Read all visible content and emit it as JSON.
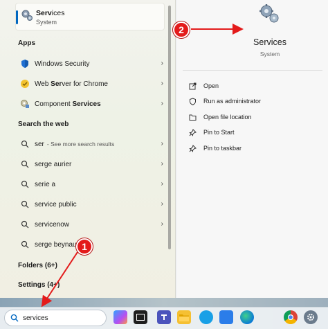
{
  "best_match": {
    "title_highlight": "Serv",
    "title_rest": "ices",
    "subtitle": "System",
    "icon": "gears-icon"
  },
  "sections": {
    "apps": "Apps",
    "web": "Search the web",
    "folders": "Folders (6+)",
    "settings": "Settings (4+)"
  },
  "apps": [
    {
      "label_pre": "Windows Security",
      "label_bold": "",
      "label_post": "",
      "icon": "shield-icon"
    },
    {
      "label_pre": "Web ",
      "label_bold": "Ser",
      "label_post": "ver for Chrome",
      "icon": "web-server-icon"
    },
    {
      "label_pre": "Component ",
      "label_bold": "Services",
      "label_post": "",
      "icon": "component-services-icon"
    }
  ],
  "web_results": [
    {
      "label": "ser",
      "sub": "- See more search results"
    },
    {
      "label": "serge aurier",
      "sub": ""
    },
    {
      "label": "serie a",
      "sub": ""
    },
    {
      "label": "service public",
      "sub": ""
    },
    {
      "label": "servicenow",
      "sub": ""
    },
    {
      "label": "serge beynau",
      "sub": ""
    }
  ],
  "detail": {
    "title": "Services",
    "subtitle": "System",
    "actions": [
      {
        "label": "Open",
        "icon": "open-icon"
      },
      {
        "label": "Run as administrator",
        "icon": "shield-admin-icon"
      },
      {
        "label": "Open file location",
        "icon": "folder-icon"
      },
      {
        "label": "Pin to Start",
        "icon": "pin-icon"
      },
      {
        "label": "Pin to taskbar",
        "icon": "pin-icon"
      }
    ]
  },
  "markers": {
    "one": "1",
    "two": "2"
  },
  "taskbar": {
    "search_value": "services",
    "icons": [
      "copilot-icon",
      "terminal-icon",
      "teams-icon",
      "file-explorer-icon",
      "app-icon",
      "snipping-icon",
      "edge-icon",
      "chrome-icon",
      "settings-icon"
    ]
  },
  "colors": {
    "accent": "#0067c0",
    "marker": "#e31b1b"
  }
}
